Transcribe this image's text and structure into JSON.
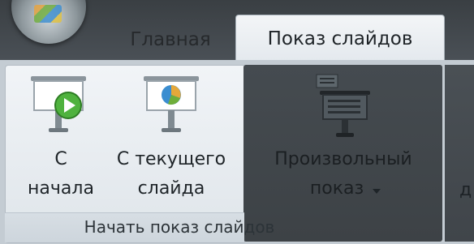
{
  "tabs": {
    "home": "Главная",
    "slideshow": "Показ слайдов"
  },
  "ribbon": {
    "from_start": {
      "line1": "С",
      "line2": "начала"
    },
    "from_current": {
      "line1": "С текущего",
      "line2": "слайда"
    },
    "custom_show": {
      "line1": "Произвольный",
      "line2": "показ"
    },
    "group_label": "Начать показ слайдов",
    "cutoff_label": "д"
  },
  "icons": {
    "office_button": "office-orb",
    "from_start": "projector-play-icon",
    "from_current": "projector-chart-icon",
    "custom_show": "projector-list-icon",
    "dropdown": "dropdown-arrow-icon"
  },
  "colors": {
    "active_tab": "#eef2f5",
    "play_green": "#4fb23e",
    "screen_white": "#ffffff"
  }
}
